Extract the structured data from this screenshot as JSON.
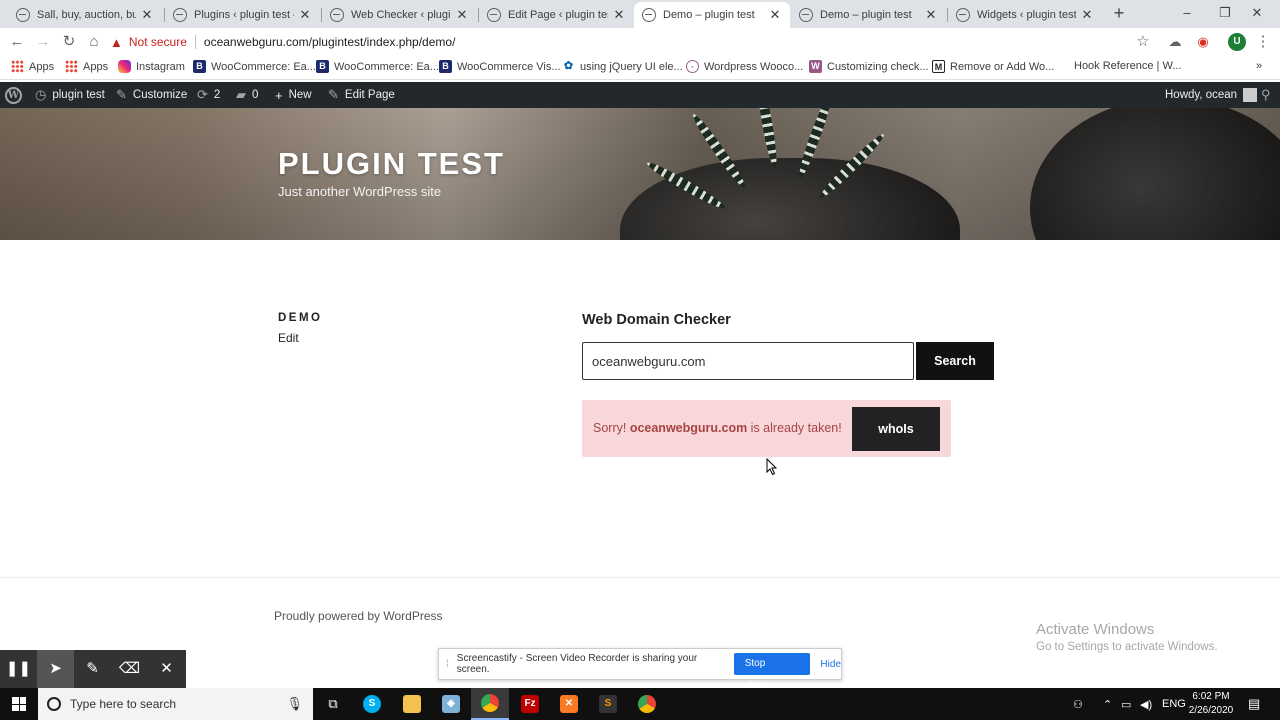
{
  "browser": {
    "tabs": [
      {
        "title": "Sall, buy, auction, busine",
        "active": false
      },
      {
        "title": "Plugins ‹ plugin test — W",
        "active": false
      },
      {
        "title": "Web Checker ‹ plugin te",
        "active": false
      },
      {
        "title": "Edit Page ‹ plugin test —",
        "active": false
      },
      {
        "title": "Demo – plugin test",
        "active": true
      },
      {
        "title": "Demo – plugin test",
        "active": false
      },
      {
        "title": "Widgets ‹ plugin test —",
        "active": false
      }
    ],
    "security_label": "Not secure",
    "url": "oceanwebguru.com/plugintest/index.php/demo/",
    "profile_initial": "U",
    "bookmarks": [
      {
        "label": "Apps",
        "icon": "apps-grid-icon"
      },
      {
        "label": "Apps",
        "icon": "apps-grid-icon"
      },
      {
        "label": "Instagram",
        "icon": "instagram-icon"
      },
      {
        "label": "WooCommerce: Ea...",
        "icon": "woocommerce-icon"
      },
      {
        "label": "WooCommerce: Ea...",
        "icon": "woocommerce-icon"
      },
      {
        "label": "WooCommerce Vis...",
        "icon": "woocommerce-icon"
      },
      {
        "label": "using jQuery UI ele...",
        "icon": "jquery-icon"
      },
      {
        "label": "Wordpress Wooco...",
        "icon": "wordpress-icon"
      },
      {
        "label": "Customizing check...",
        "icon": "woo-w-icon"
      },
      {
        "label": "Remove or Add Wo...",
        "icon": "m-icon"
      },
      {
        "label": "Hook Reference | W...",
        "icon": "none"
      }
    ]
  },
  "adminbar": {
    "site_name": "plugin test",
    "customize": "Customize",
    "updates_count": "2",
    "comments_count": "0",
    "new_label": "New",
    "edit_page": "Edit Page",
    "howdy": "Howdy, ocean"
  },
  "site": {
    "title": "PLUGIN TEST",
    "description": "Just another WordPress site"
  },
  "page": {
    "title": "DEMO",
    "edit_label": "Edit"
  },
  "checker": {
    "title": "Web Domain Checker",
    "input_value": "oceanwebguru.com",
    "search_label": "Search",
    "result_prefix": "Sorry! ",
    "result_domain": "oceanwebguru.com",
    "result_suffix": " is already taken!",
    "whois_label": "whoIs",
    "result_color": "#f8d7da"
  },
  "footer": {
    "powered_by": "Proudly powered by WordPress"
  },
  "watermark": {
    "line1": "Activate Windows",
    "line2": "Go to Settings to activate Windows."
  },
  "screencastify": {
    "message": "Screencastify - Screen Video Recorder is sharing your screen.",
    "stop_label": "Stop sharing",
    "hide_label": "Hide"
  },
  "taskbar": {
    "search_placeholder": "Type here to search",
    "language": "ENG",
    "time": "6:02 PM",
    "date": "2/26/2020"
  }
}
